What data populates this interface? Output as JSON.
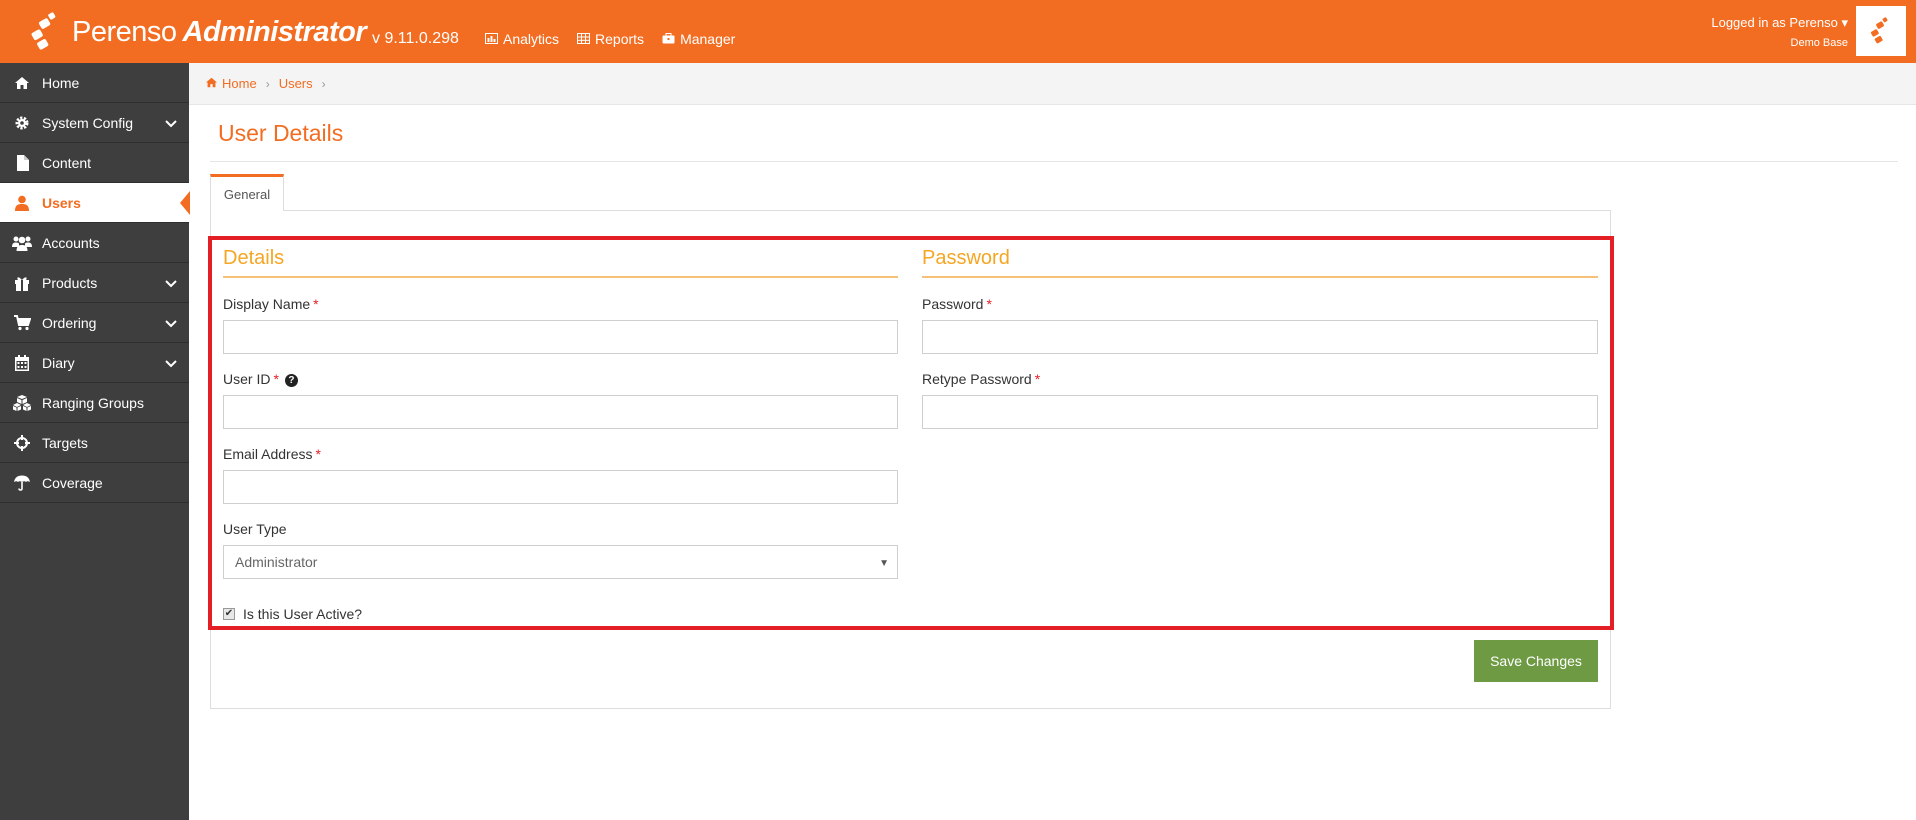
{
  "app": {
    "logo_text": "Perenso",
    "logo_bold": "Administrator",
    "version": "v 9.11.0.298"
  },
  "topnav": {
    "items": [
      {
        "label": "Analytics",
        "icon": "chart-icon"
      },
      {
        "label": "Reports",
        "icon": "table-icon"
      },
      {
        "label": "Manager",
        "icon": "briefcase-icon"
      }
    ]
  },
  "user": {
    "logged_in": "Logged in as Perenso",
    "database": "Demo Base"
  },
  "sidebar": {
    "items": [
      {
        "label": "Home",
        "icon": "home-icon",
        "has_children": false,
        "active": false
      },
      {
        "label": "System Config",
        "icon": "gear-icon",
        "has_children": true,
        "active": false
      },
      {
        "label": "Content",
        "icon": "file-icon",
        "has_children": false,
        "active": false
      },
      {
        "label": "Users",
        "icon": "user-icon",
        "has_children": false,
        "active": true
      },
      {
        "label": "Accounts",
        "icon": "users-icon",
        "has_children": false,
        "active": false
      },
      {
        "label": "Products",
        "icon": "gift-icon",
        "has_children": true,
        "active": false
      },
      {
        "label": "Ordering",
        "icon": "cart-icon",
        "has_children": true,
        "active": false
      },
      {
        "label": "Diary",
        "icon": "calendar-icon",
        "has_children": true,
        "active": false
      },
      {
        "label": "Ranging Groups",
        "icon": "cubes-icon",
        "has_children": false,
        "active": false
      },
      {
        "label": "Targets",
        "icon": "crosshairs-icon",
        "has_children": false,
        "active": false
      },
      {
        "label": "Coverage",
        "icon": "umbrella-icon",
        "has_children": false,
        "active": false
      }
    ]
  },
  "breadcrumb": {
    "home": "Home",
    "users": "Users"
  },
  "page": {
    "title": "User Details",
    "tab_general": "General"
  },
  "details": {
    "heading": "Details",
    "display_name_label": "Display Name",
    "display_name_value": "",
    "user_id_label": "User ID",
    "user_id_value": "",
    "email_label": "Email Address",
    "email_value": "",
    "user_type_label": "User Type",
    "user_type_value": "Administrator",
    "active_label": "Is this User Active?",
    "active_checked": true,
    "required_mark": "*",
    "help_mark": "?"
  },
  "password": {
    "heading": "Password",
    "password_label": "Password",
    "password_value": "",
    "retype_label": "Retype Password",
    "retype_value": ""
  },
  "actions": {
    "save_label": "Save Changes"
  },
  "colors": {
    "brand": "#f26d21",
    "section_heading": "#f5a623",
    "save_button": "#6e9a44",
    "highlight": "#e31e25"
  }
}
